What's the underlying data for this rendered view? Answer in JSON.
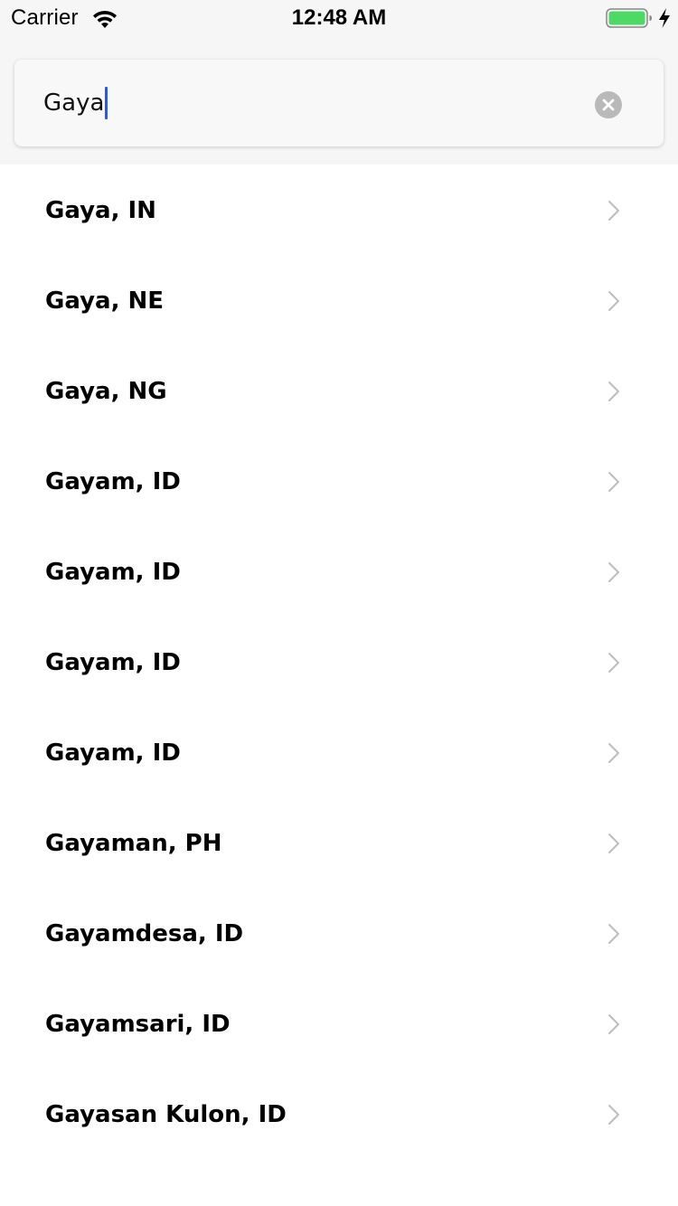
{
  "status_bar": {
    "carrier": "Carrier",
    "time": "12:48 AM",
    "battery_color": "#4cd964"
  },
  "search": {
    "value": "Gaya",
    "caret_color": "#2f57e0"
  },
  "results": [
    {
      "label": "Gaya, IN"
    },
    {
      "label": "Gaya, NE"
    },
    {
      "label": "Gaya, NG"
    },
    {
      "label": "Gayam, ID"
    },
    {
      "label": "Gayam, ID"
    },
    {
      "label": "Gayam, ID"
    },
    {
      "label": "Gayam, ID"
    },
    {
      "label": "Gayaman, PH"
    },
    {
      "label": "Gayamdesa, ID"
    },
    {
      "label": "Gayamsari, ID"
    },
    {
      "label": "Gayasan Kulon, ID"
    }
  ]
}
